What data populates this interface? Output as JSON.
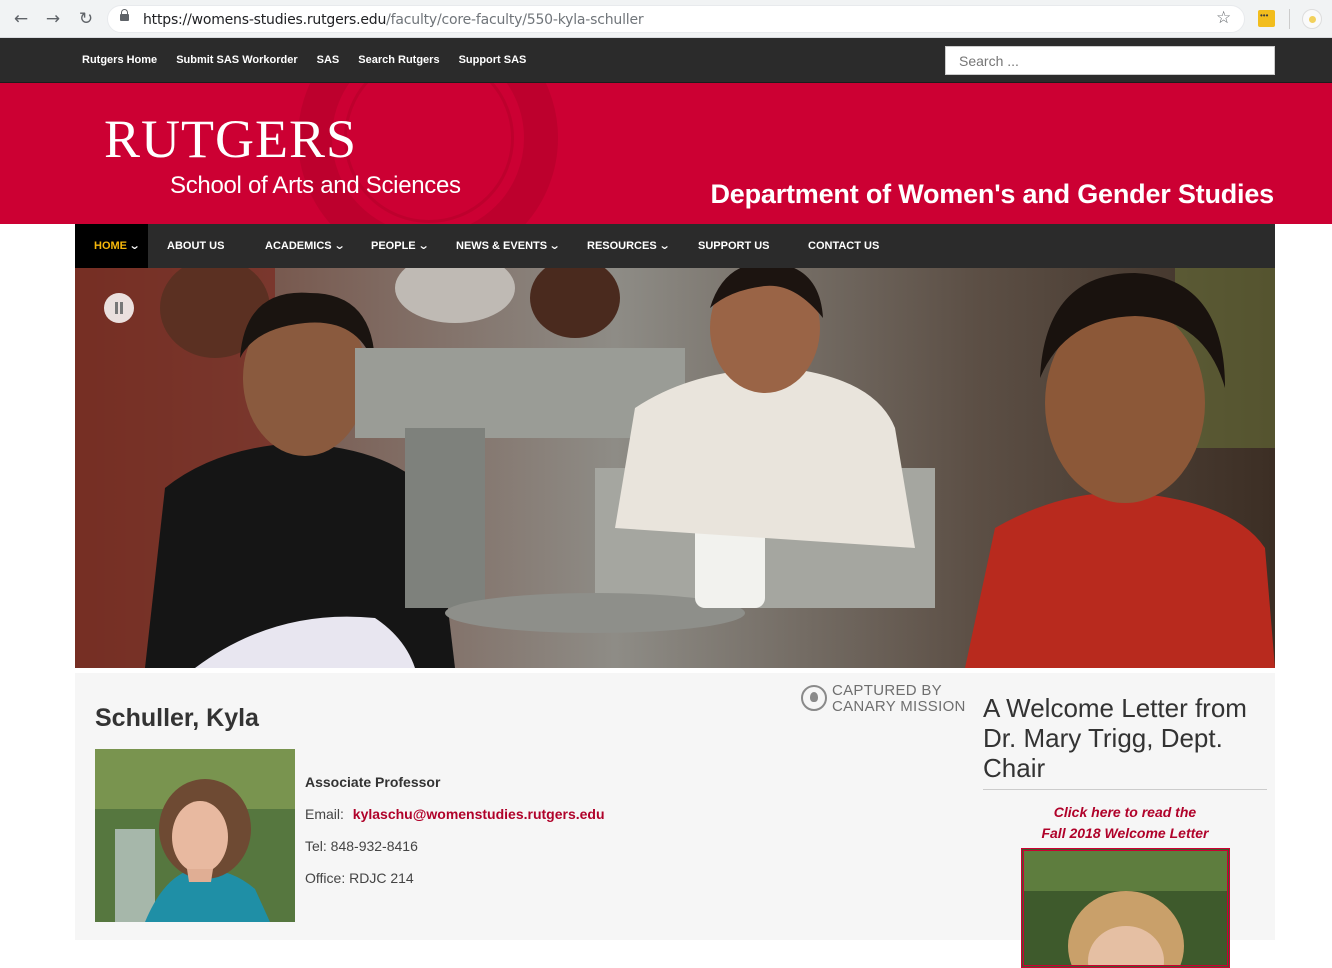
{
  "browser": {
    "url_host": "https://womens-studies.rutgers.edu",
    "url_path": "/faculty/core-faculty/550-kyla-schuller",
    "icons": [
      "back-icon",
      "forward-icon",
      "reload-icon",
      "lock-icon",
      "star-icon",
      "extension-icon",
      "profile-icon"
    ]
  },
  "utility_nav": {
    "links": [
      "Rutgers Home",
      "Submit SAS Workorder",
      "SAS",
      "Search Rutgers",
      "Support SAS"
    ],
    "search_placeholder": "Search ..."
  },
  "header": {
    "logo_main": "RUTGERS",
    "logo_sub": "School of Arts and Sciences",
    "department": "Department of Women's and Gender Studies",
    "brand_color": "#cc0033"
  },
  "main_nav": {
    "items": [
      {
        "label": "HOME",
        "dropdown": true,
        "active": true
      },
      {
        "label": "ABOUT US",
        "dropdown": false
      },
      {
        "label": "ACADEMICS",
        "dropdown": true
      },
      {
        "label": "PEOPLE",
        "dropdown": true
      },
      {
        "label": "NEWS & EVENTS",
        "dropdown": true
      },
      {
        "label": "RESOURCES",
        "dropdown": true
      },
      {
        "label": "SUPPORT US",
        "dropdown": false
      },
      {
        "label": "CONTACT US",
        "dropdown": false
      }
    ],
    "active_color": "#f6b80b"
  },
  "canary": {
    "line1": "CAPTURED BY",
    "line2": "CANARY MISSION"
  },
  "profile": {
    "name": "Schuller, Kyla",
    "position": "Associate Professor",
    "email_label": "Email:",
    "email": "kylaschu@womenstudies.rutgers.edu",
    "tel": "Tel: 848-932-8416",
    "office": "Office: RDJC 214"
  },
  "sidebar": {
    "heading": "A Welcome Letter from Dr. Mary Trigg, Dept. Chair",
    "link_line1": "Click here to read the",
    "link_line2": "Fall 2018 Welcome Letter"
  }
}
